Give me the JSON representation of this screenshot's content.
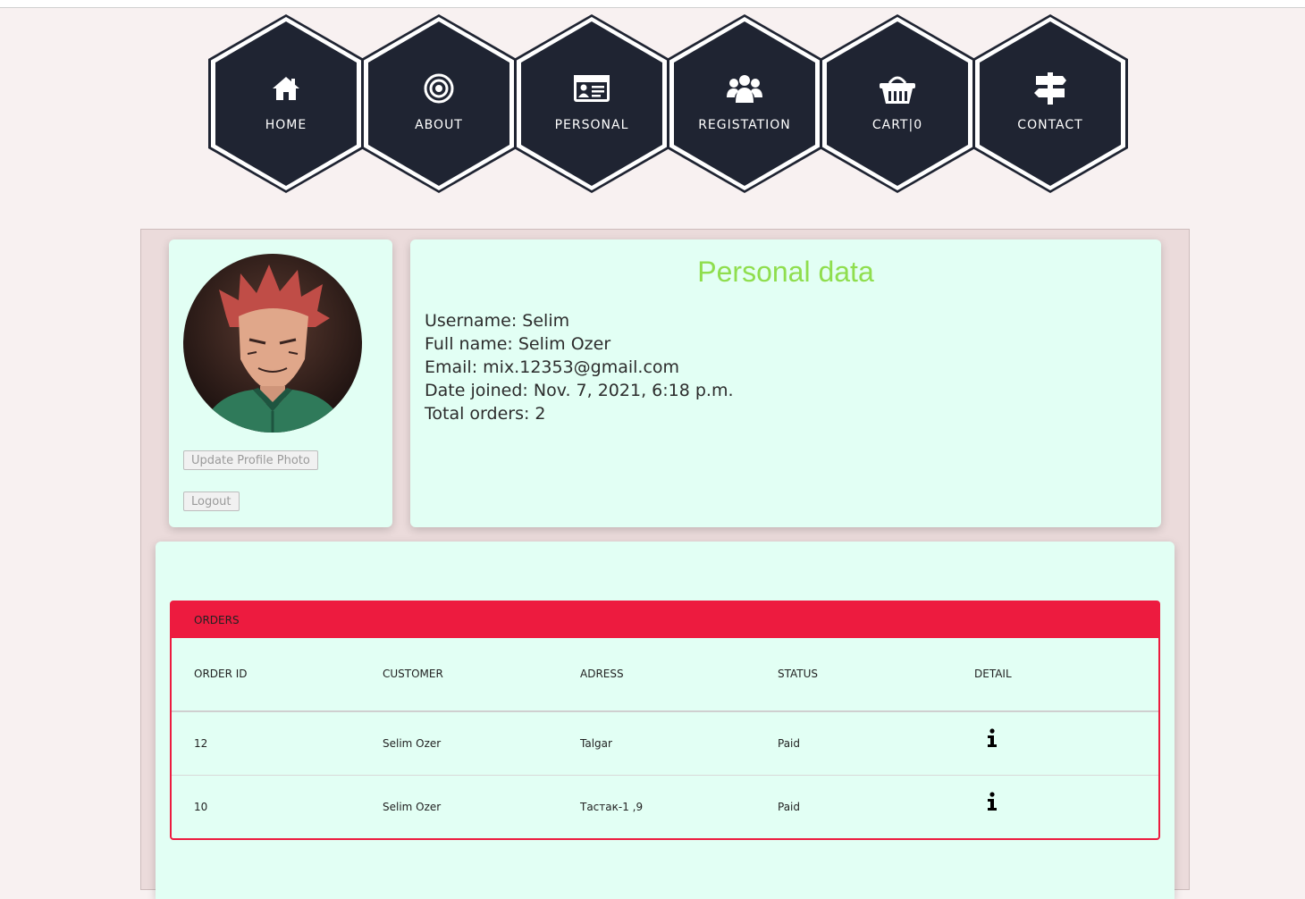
{
  "nav": [
    {
      "label": "HOME",
      "icon": "home-icon"
    },
    {
      "label": "ABOUT",
      "icon": "target-icon"
    },
    {
      "label": "PERSONAL",
      "icon": "id-card-icon"
    },
    {
      "label": "REGISTATION",
      "icon": "users-icon"
    },
    {
      "label": "CART|0",
      "icon": "basket-icon"
    },
    {
      "label": "CONTACT",
      "icon": "signpost-icon"
    }
  ],
  "profile": {
    "update_photo_label": "Update Profile Photo",
    "logout_label": "Logout"
  },
  "personal": {
    "title": "Personal data",
    "username": "Username: Selim",
    "full_name": "Full name: Selim Ozer",
    "email": "Email: mix.12353@gmail.com",
    "date_joined": "Date joined: Nov. 7, 2021, 6:18 p.m.",
    "total_orders": "Total orders: 2"
  },
  "orders": {
    "title": "ORDERS",
    "columns": [
      "ORDER ID",
      "CUSTOMER",
      "ADRESS",
      "STATUS",
      "DETAIL"
    ],
    "rows": [
      {
        "id": "12",
        "customer": "Selim Ozer",
        "address": "Talgar",
        "status": "Paid",
        "detail_icon": "info-icon"
      },
      {
        "id": "10",
        "customer": "Selim Ozer",
        "address": "Тастак-1 ,9",
        "status": "Paid",
        "detail_icon": "info-icon"
      }
    ]
  },
  "colors": {
    "hex_fill": "#1f2432",
    "accent_red": "#ed1b3f",
    "title_green": "#8fde4e",
    "card_bg": "#e2fff4",
    "page_bg": "#f8f1f1"
  }
}
